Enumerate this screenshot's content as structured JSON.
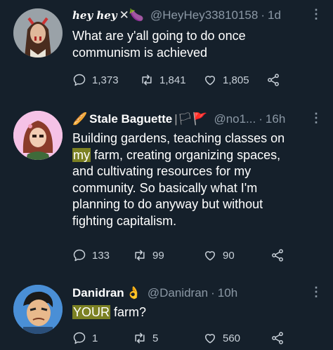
{
  "tweets": [
    {
      "name": "hey hey",
      "name_suffix": "✕🍆",
      "handle": "@HeyHey33810158",
      "time": "1d",
      "lines": [
        "What are y'all going to do once",
        "communism is achieved"
      ],
      "replies": "1,373",
      "retweets": "1,841",
      "likes": "1,805"
    },
    {
      "name": "Stale Baguette",
      "name_prefix": "🥖",
      "name_suffix": "|🏳🚩",
      "handle": "@no1...",
      "time": "16h",
      "lines": [
        "Building gardens, teaching classes on",
        "farm,  creating organizing spaces,",
        "and cultivating resources for my",
        "community. So basically what I'm",
        "planning to do anyway but without",
        "fighting capitalism."
      ],
      "highlight_my": "my",
      "replies": "133",
      "retweets": "99",
      "likes": "90"
    },
    {
      "name": "Danidran",
      "name_suffix": "👌",
      "handle": "@Danidran",
      "time": "10h",
      "highlight_your": "YOUR",
      "line_rest": " farm?",
      "replies": "1",
      "retweets": "5",
      "likes": "560"
    }
  ],
  "colors": {
    "background": "#15202b",
    "text": "#ffffff",
    "muted": "#8b98a5",
    "highlight": "#d2d21e"
  },
  "icons": [
    "reply-icon",
    "retweet-icon",
    "like-icon",
    "share-icon",
    "more-icon"
  ]
}
